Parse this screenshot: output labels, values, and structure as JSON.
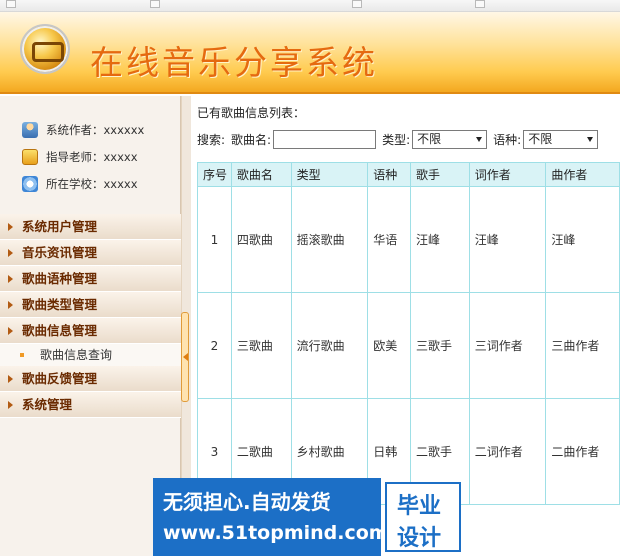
{
  "header": {
    "title": "在线音乐分享系统"
  },
  "sidebar": {
    "info": [
      {
        "label": "系统作者：xxxxxx",
        "icon": "user-icon"
      },
      {
        "label": "指导老师：xxxxx",
        "icon": "teacher-icon"
      },
      {
        "label": "所在学校：xxxxx",
        "icon": "school-icon"
      }
    ],
    "nav": [
      {
        "label": "系统用户管理"
      },
      {
        "label": "音乐资讯管理"
      },
      {
        "label": "歌曲语种管理"
      },
      {
        "label": "歌曲类型管理"
      },
      {
        "label": "歌曲信息管理"
      },
      {
        "label": "歌曲信息查询"
      },
      {
        "label": "歌曲反馈管理"
      },
      {
        "label": "系统管理"
      }
    ]
  },
  "main": {
    "list_title": "已有歌曲信息列表：",
    "search": {
      "label": "搜索:",
      "song_name_label": "歌曲名:",
      "song_name_value": "",
      "type_label": "类型:",
      "type_value": "不限",
      "lang_label": "语种:",
      "lang_value": "不限"
    },
    "table": {
      "headers": [
        "序号",
        "歌曲名",
        "类型",
        "语种",
        "歌手",
        "词作者",
        "曲作者"
      ],
      "rows": [
        [
          "1",
          "四歌曲",
          "摇滚歌曲",
          "华语",
          "汪峰",
          "汪峰",
          "汪峰"
        ],
        [
          "2",
          "三歌曲",
          "流行歌曲",
          "欧美",
          "三歌手",
          "三词作者",
          "三曲作者"
        ],
        [
          "3",
          "二歌曲",
          "乡村歌曲",
          "日韩",
          "二歌手",
          "二词作者",
          "二曲作者"
        ]
      ]
    }
  },
  "watermark": {
    "line1": "无须担心.自动发货",
    "line2": "www.51topmind.com",
    "badge1": "毕业",
    "badge2": "设计"
  }
}
